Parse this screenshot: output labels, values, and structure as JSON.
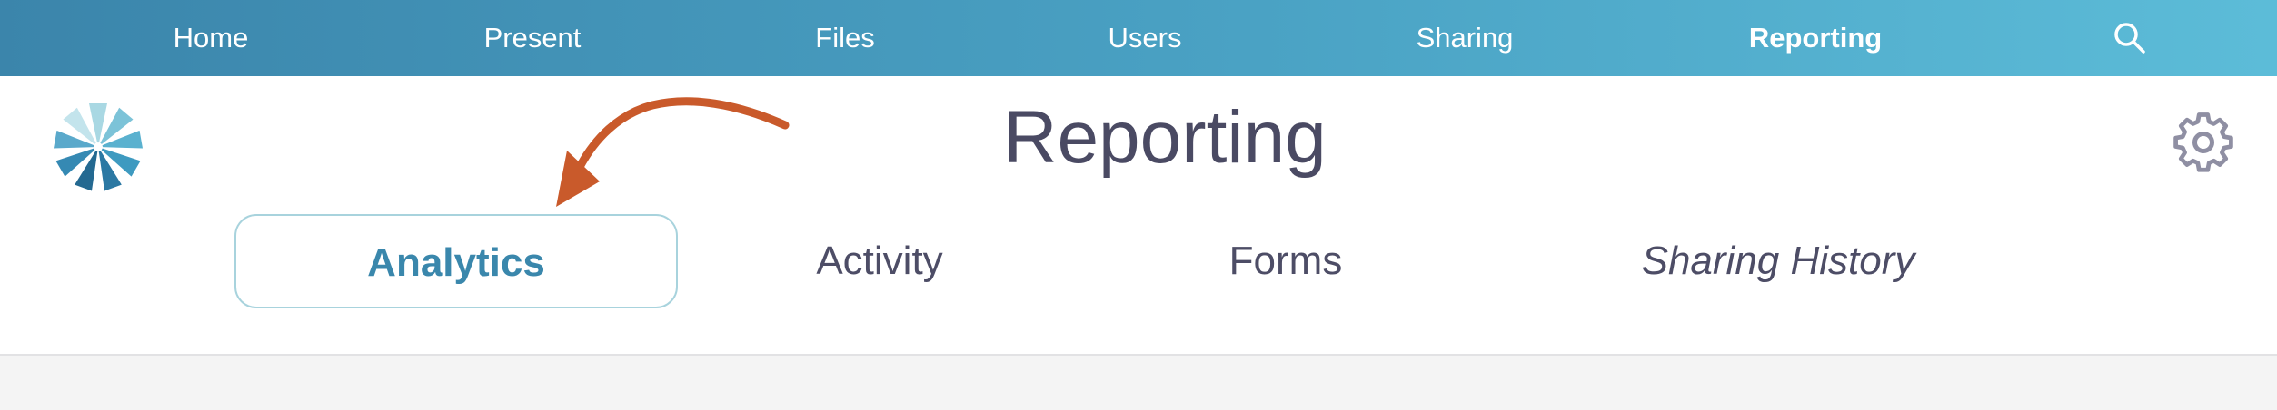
{
  "topnav": {
    "items": [
      {
        "label": "Home"
      },
      {
        "label": "Present"
      },
      {
        "label": "Files"
      },
      {
        "label": "Users"
      },
      {
        "label": "Sharing"
      },
      {
        "label": "Reporting",
        "active": true
      }
    ],
    "search_icon": "search-icon",
    "gradient": [
      "#3b85ab",
      "#5cbcd8"
    ]
  },
  "header": {
    "title": "Reporting",
    "logo_icon": "flower-logo-icon",
    "settings_icon": "gear-icon"
  },
  "tabs": [
    {
      "label": "Analytics",
      "active": true
    },
    {
      "label": "Activity"
    },
    {
      "label": "Forms"
    },
    {
      "label": "Sharing History"
    }
  ],
  "annotation": {
    "icon": "curved-arrow-icon",
    "color": "#c95a2b"
  },
  "colors": {
    "accent": "#3a87ac",
    "text": "#4a4a63",
    "tab_border": "#a8d3dd",
    "content_bg": "#f4f4f4"
  }
}
